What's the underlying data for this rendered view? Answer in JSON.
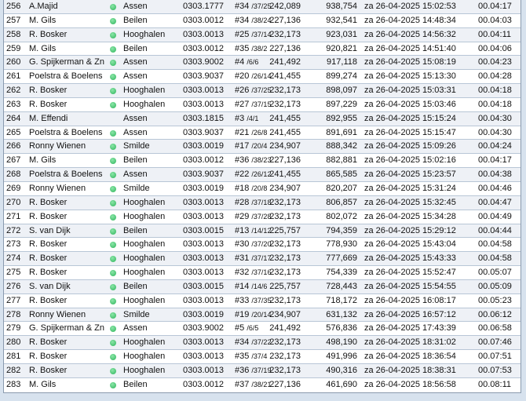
{
  "colors": {
    "status_dot": "#2fb45c",
    "row_alt": "#eef1f6",
    "background": "#d7e2ee"
  },
  "rows": [
    {
      "num": "256",
      "name": "A.Majid",
      "status": true,
      "city": "Assen",
      "code": "0303.1777",
      "ring": "#34",
      "ring_sub": "/37/25",
      "dist": "242,089",
      "speed": "938,754",
      "time": "za 26-04-2025 15:02:53",
      "dur": "00.04:17"
    },
    {
      "num": "257",
      "name": "M. Gils",
      "status": true,
      "city": "Beilen",
      "code": "0303.0012",
      "ring": "#34",
      "ring_sub": "/38/24",
      "dist": "227,136",
      "speed": "932,541",
      "time": "za 26-04-2025 14:48:34",
      "dur": "00.04:03"
    },
    {
      "num": "258",
      "name": "R. Bosker",
      "status": true,
      "city": "Hooghalen",
      "code": "0303.0013",
      "ring": "#25",
      "ring_sub": "/37/14",
      "dist": "232,173",
      "speed": "923,031",
      "time": "za 26-04-2025 14:56:32",
      "dur": "00.04:11"
    },
    {
      "num": "259",
      "name": "M. Gils",
      "status": true,
      "city": "Beilen",
      "code": "0303.0012",
      "ring": "#35",
      "ring_sub": "/38/2",
      "dist": "227,136",
      "speed": "920,821",
      "time": "za 26-04-2025 14:51:40",
      "dur": "00.04:06"
    },
    {
      "num": "260",
      "name": "G. Spijkerman & Zn",
      "status": true,
      "city": "Assen",
      "code": "0303.9002",
      "ring": "#4",
      "ring_sub": "/6/6",
      "dist": "241,492",
      "speed": "917,118",
      "time": "za 26-04-2025 15:08:19",
      "dur": "00.04:23"
    },
    {
      "num": "261",
      "name": "Poelstra & Boelens",
      "status": true,
      "city": "Assen",
      "code": "0303.9037",
      "ring": "#20",
      "ring_sub": "/26/14",
      "dist": "241,455",
      "speed": "899,274",
      "time": "za 26-04-2025 15:13:30",
      "dur": "00.04:28"
    },
    {
      "num": "262",
      "name": "R. Bosker",
      "status": true,
      "city": "Hooghalen",
      "code": "0303.0013",
      "ring": "#26",
      "ring_sub": "/37/25",
      "dist": "232,173",
      "speed": "898,097",
      "time": "za 26-04-2025 15:03:31",
      "dur": "00.04:18"
    },
    {
      "num": "263",
      "name": "R. Bosker",
      "status": true,
      "city": "Hooghalen",
      "code": "0303.0013",
      "ring": "#27",
      "ring_sub": "/37/15",
      "dist": "232,173",
      "speed": "897,229",
      "time": "za 26-04-2025 15:03:46",
      "dur": "00.04:18"
    },
    {
      "num": "264",
      "name": "M. Effendi",
      "status": false,
      "city": "Assen",
      "code": "0303.1815",
      "ring": "#3",
      "ring_sub": "/4/1",
      "dist": "241,455",
      "speed": "892,955",
      "time": "za 26-04-2025 15:15:24",
      "dur": "00.04:30"
    },
    {
      "num": "265",
      "name": "Poelstra & Boelens",
      "status": true,
      "city": "Assen",
      "code": "0303.9037",
      "ring": "#21",
      "ring_sub": "/26/8",
      "dist": "241,455",
      "speed": "891,691",
      "time": "za 26-04-2025 15:15:47",
      "dur": "00.04:30"
    },
    {
      "num": "266",
      "name": "Ronny Wienen",
      "status": true,
      "city": "Smilde",
      "code": "0303.0019",
      "ring": "#17",
      "ring_sub": "/20/4",
      "dist": "234,907",
      "speed": "888,342",
      "time": "za 26-04-2025 15:09:26",
      "dur": "00.04:24"
    },
    {
      "num": "267",
      "name": "M. Gils",
      "status": true,
      "city": "Beilen",
      "code": "0303.0012",
      "ring": "#36",
      "ring_sub": "/38/23",
      "dist": "227,136",
      "speed": "882,881",
      "time": "za 26-04-2025 15:02:16",
      "dur": "00.04:17"
    },
    {
      "num": "268",
      "name": "Poelstra & Boelens",
      "status": true,
      "city": "Assen",
      "code": "0303.9037",
      "ring": "#22",
      "ring_sub": "/26/12",
      "dist": "241,455",
      "speed": "865,585",
      "time": "za 26-04-2025 15:23:57",
      "dur": "00.04:38"
    },
    {
      "num": "269",
      "name": "Ronny Wienen",
      "status": true,
      "city": "Smilde",
      "code": "0303.0019",
      "ring": "#18",
      "ring_sub": "/20/8",
      "dist": "234,907",
      "speed": "820,207",
      "time": "za 26-04-2025 15:31:24",
      "dur": "00.04:46"
    },
    {
      "num": "270",
      "name": "R. Bosker",
      "status": true,
      "city": "Hooghalen",
      "code": "0303.0013",
      "ring": "#28",
      "ring_sub": "/37/18",
      "dist": "232,173",
      "speed": "806,857",
      "time": "za 26-04-2025 15:32:45",
      "dur": "00.04:47"
    },
    {
      "num": "271",
      "name": "R. Bosker",
      "status": true,
      "city": "Hooghalen",
      "code": "0303.0013",
      "ring": "#29",
      "ring_sub": "/37/28",
      "dist": "232,173",
      "speed": "802,072",
      "time": "za 26-04-2025 15:34:28",
      "dur": "00.04:49"
    },
    {
      "num": "272",
      "name": "S. van Dijk",
      "status": true,
      "city": "Beilen",
      "code": "0303.0015",
      "ring": "#13",
      "ring_sub": "/14/12",
      "dist": "225,757",
      "speed": "794,359",
      "time": "za 26-04-2025 15:29:12",
      "dur": "00.04:44"
    },
    {
      "num": "273",
      "name": "R. Bosker",
      "status": true,
      "city": "Hooghalen",
      "code": "0303.0013",
      "ring": "#30",
      "ring_sub": "/37/20",
      "dist": "232,173",
      "speed": "778,930",
      "time": "za 26-04-2025 15:43:04",
      "dur": "00.04:58"
    },
    {
      "num": "274",
      "name": "R. Bosker",
      "status": true,
      "city": "Hooghalen",
      "code": "0303.0013",
      "ring": "#31",
      "ring_sub": "/37/17",
      "dist": "232,173",
      "speed": "777,669",
      "time": "za 26-04-2025 15:43:33",
      "dur": "00.04:58"
    },
    {
      "num": "275",
      "name": "R. Bosker",
      "status": true,
      "city": "Hooghalen",
      "code": "0303.0013",
      "ring": "#32",
      "ring_sub": "/37/16",
      "dist": "232,173",
      "speed": "754,339",
      "time": "za 26-04-2025 15:52:47",
      "dur": "00.05:07"
    },
    {
      "num": "276",
      "name": "S. van Dijk",
      "status": true,
      "city": "Beilen",
      "code": "0303.0015",
      "ring": "#14",
      "ring_sub": "/14/6",
      "dist": "225,757",
      "speed": "728,443",
      "time": "za 26-04-2025 15:54:55",
      "dur": "00.05:09"
    },
    {
      "num": "277",
      "name": "R. Bosker",
      "status": true,
      "city": "Hooghalen",
      "code": "0303.0013",
      "ring": "#33",
      "ring_sub": "/37/35",
      "dist": "232,173",
      "speed": "718,172",
      "time": "za 26-04-2025 16:08:17",
      "dur": "00.05:23"
    },
    {
      "num": "278",
      "name": "Ronny Wienen",
      "status": true,
      "city": "Smilde",
      "code": "0303.0019",
      "ring": "#19",
      "ring_sub": "/20/14",
      "dist": "234,907",
      "speed": "631,132",
      "time": "za 26-04-2025 16:57:12",
      "dur": "00.06:12"
    },
    {
      "num": "279",
      "name": "G. Spijkerman & Zn",
      "status": true,
      "city": "Assen",
      "code": "0303.9002",
      "ring": "#5",
      "ring_sub": "/6/5",
      "dist": "241,492",
      "speed": "576,836",
      "time": "za 26-04-2025 17:43:39",
      "dur": "00.06:58"
    },
    {
      "num": "280",
      "name": "R. Bosker",
      "status": true,
      "city": "Hooghalen",
      "code": "0303.0013",
      "ring": "#34",
      "ring_sub": "/37/22",
      "dist": "232,173",
      "speed": "498,190",
      "time": "za 26-04-2025 18:31:02",
      "dur": "00.07:46"
    },
    {
      "num": "281",
      "name": "R. Bosker",
      "status": true,
      "city": "Hooghalen",
      "code": "0303.0013",
      "ring": "#35",
      "ring_sub": "/37/4",
      "dist": "232,173",
      "speed": "491,996",
      "time": "za 26-04-2025 18:36:54",
      "dur": "00.07:51"
    },
    {
      "num": "282",
      "name": "R. Bosker",
      "status": true,
      "city": "Hooghalen",
      "code": "0303.0013",
      "ring": "#36",
      "ring_sub": "/37/19",
      "dist": "232,173",
      "speed": "490,316",
      "time": "za 26-04-2025 18:38:31",
      "dur": "00.07:53"
    },
    {
      "num": "283",
      "name": "M. Gils",
      "status": true,
      "city": "Beilen",
      "code": "0303.0012",
      "ring": "#37",
      "ring_sub": "/38/21",
      "dist": "227,136",
      "speed": "461,690",
      "time": "za 26-04-2025 18:56:58",
      "dur": "00.08:11"
    }
  ]
}
